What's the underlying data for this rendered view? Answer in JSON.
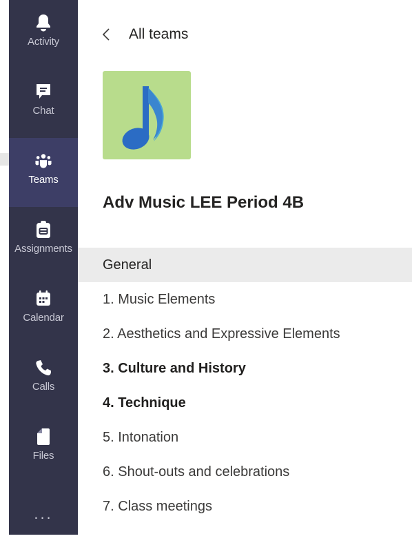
{
  "rail": {
    "items": [
      {
        "label": "Activity",
        "icon": "bell-icon"
      },
      {
        "label": "Chat",
        "icon": "chat-icon"
      },
      {
        "label": "Teams",
        "icon": "teams-icon",
        "active": true
      },
      {
        "label": "Assignments",
        "icon": "assignments-icon"
      },
      {
        "label": "Calendar",
        "icon": "calendar-icon"
      },
      {
        "label": "Calls",
        "icon": "phone-icon"
      },
      {
        "label": "Files",
        "icon": "file-icon"
      }
    ],
    "more_label": "...",
    "colors": {
      "background": "#33344a",
      "active": "#3d3e66",
      "text": "#c8c8d4"
    }
  },
  "header": {
    "back_label": "All teams"
  },
  "team": {
    "name": "Adv Music LEE Period 4B",
    "logo": {
      "icon": "music-note-icon",
      "background": "#b8dc8c",
      "note_color": "#2b6cc4"
    }
  },
  "channels": [
    {
      "label": "General",
      "selected": true
    },
    {
      "label": "1. Music Elements"
    },
    {
      "label": "2. Aesthetics and Expressive Elements"
    },
    {
      "label": "3. Culture and History",
      "unread": true
    },
    {
      "label": "4. Technique",
      "unread": true
    },
    {
      "label": "5. Intonation"
    },
    {
      "label": "6. Shout-outs and celebrations"
    },
    {
      "label": "7. Class meetings"
    }
  ]
}
